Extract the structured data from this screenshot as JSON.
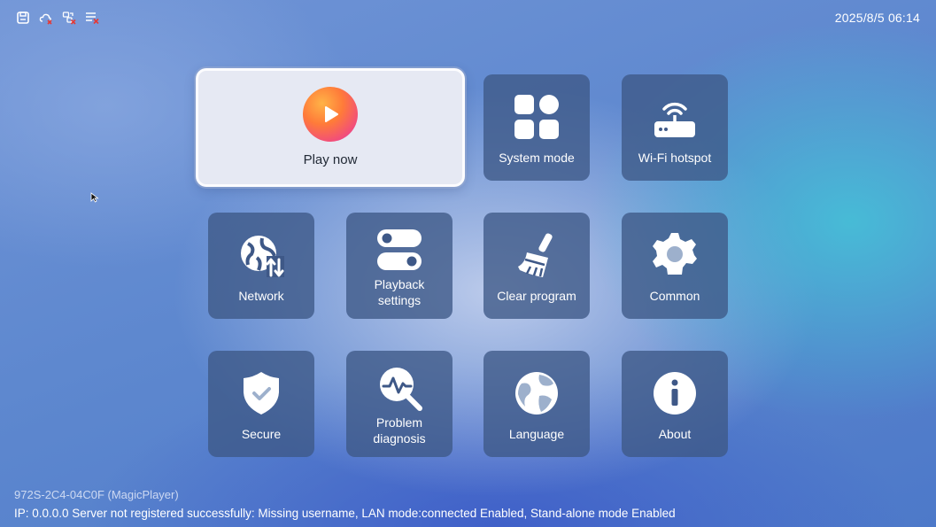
{
  "status_bar": {
    "icons": [
      "save-icon",
      "cloud-error-icon",
      "sync-error-icon",
      "list-error-icon"
    ],
    "datetime": "2025/8/5 06:14"
  },
  "menu": {
    "play_now": "Play now",
    "tiles": [
      {
        "id": "system-mode",
        "label": "System mode",
        "icon": "grid-icon"
      },
      {
        "id": "wifi-hotspot",
        "label": "Wi-Fi hotspot",
        "icon": "router-icon"
      },
      {
        "id": "network",
        "label": "Network",
        "icon": "globe-network-icon"
      },
      {
        "id": "playback-settings",
        "label": "Playback\nsettings",
        "icon": "toggle-icon"
      },
      {
        "id": "clear-program",
        "label": "Clear program",
        "icon": "broom-icon"
      },
      {
        "id": "common",
        "label": "Common",
        "icon": "gear-icon"
      },
      {
        "id": "secure",
        "label": "Secure",
        "icon": "shield-icon"
      },
      {
        "id": "problem-diagnosis",
        "label": "Problem\ndiagnosis",
        "icon": "diagnosis-icon"
      },
      {
        "id": "language",
        "label": "Language",
        "icon": "globe-icon"
      },
      {
        "id": "about",
        "label": "About",
        "icon": "info-icon"
      }
    ]
  },
  "footer": {
    "device": "972S-2C4-04C0F (MagicPlayer)",
    "ip_line": "IP: 0.0.0.0  Server not registered successfully: Missing username, LAN mode:connected Enabled, Stand-alone mode Enabled"
  },
  "colors": {
    "tile_bg": "#3e5887",
    "play_bg": "#e6e9f3",
    "error_red": "#e53935"
  }
}
